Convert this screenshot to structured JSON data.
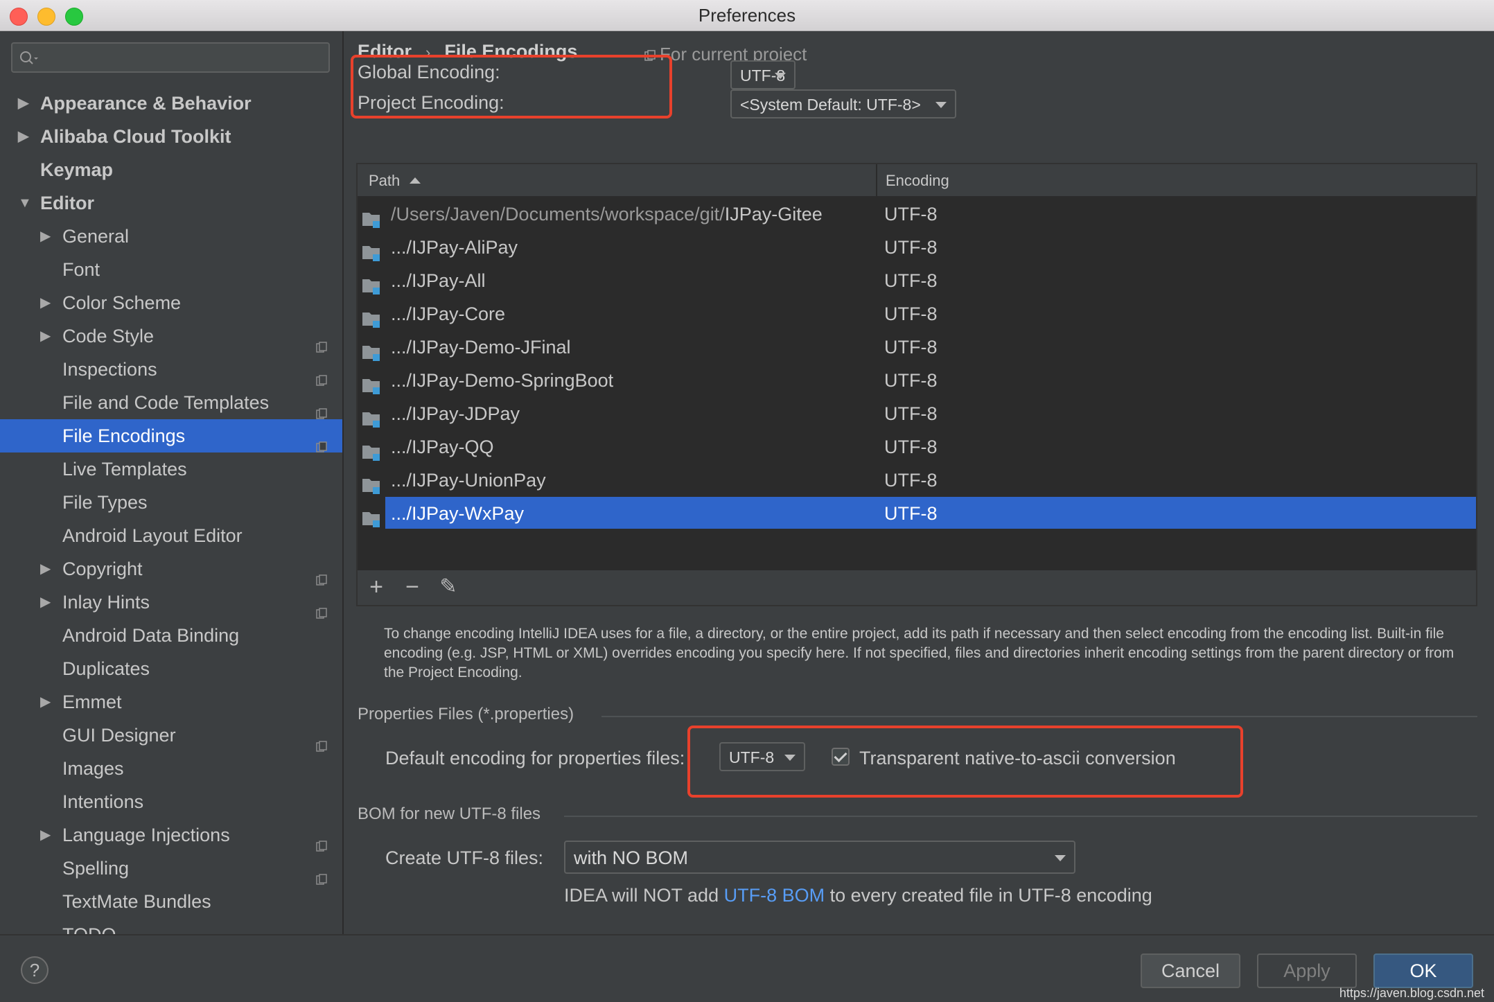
{
  "window": {
    "title": "Preferences"
  },
  "search": {
    "placeholder": ""
  },
  "sidebar": {
    "items": [
      {
        "label": "Appearance & Behavior",
        "bold": true,
        "indent": 0,
        "arrow": "right",
        "project": false
      },
      {
        "label": "Alibaba Cloud Toolkit",
        "bold": true,
        "indent": 0,
        "arrow": "right",
        "project": false
      },
      {
        "label": "Keymap",
        "bold": true,
        "indent": 0,
        "arrow": "",
        "project": false
      },
      {
        "label": "Editor",
        "bold": true,
        "indent": 0,
        "arrow": "down",
        "project": false
      },
      {
        "label": "General",
        "bold": false,
        "indent": 1,
        "arrow": "right",
        "project": false
      },
      {
        "label": "Font",
        "bold": false,
        "indent": 1,
        "arrow": "",
        "project": false
      },
      {
        "label": "Color Scheme",
        "bold": false,
        "indent": 1,
        "arrow": "right",
        "project": false
      },
      {
        "label": "Code Style",
        "bold": false,
        "indent": 1,
        "arrow": "right",
        "project": true
      },
      {
        "label": "Inspections",
        "bold": false,
        "indent": 1,
        "arrow": "",
        "project": true
      },
      {
        "label": "File and Code Templates",
        "bold": false,
        "indent": 1,
        "arrow": "",
        "project": true
      },
      {
        "label": "File Encodings",
        "bold": false,
        "indent": 1,
        "arrow": "",
        "project": true,
        "selected": true
      },
      {
        "label": "Live Templates",
        "bold": false,
        "indent": 1,
        "arrow": "",
        "project": false
      },
      {
        "label": "File Types",
        "bold": false,
        "indent": 1,
        "arrow": "",
        "project": false
      },
      {
        "label": "Android Layout Editor",
        "bold": false,
        "indent": 1,
        "arrow": "",
        "project": false
      },
      {
        "label": "Copyright",
        "bold": false,
        "indent": 1,
        "arrow": "right",
        "project": true
      },
      {
        "label": "Inlay Hints",
        "bold": false,
        "indent": 1,
        "arrow": "right",
        "project": true
      },
      {
        "label": "Android Data Binding",
        "bold": false,
        "indent": 1,
        "arrow": "",
        "project": false
      },
      {
        "label": "Duplicates",
        "bold": false,
        "indent": 1,
        "arrow": "",
        "project": false
      },
      {
        "label": "Emmet",
        "bold": false,
        "indent": 1,
        "arrow": "right",
        "project": false
      },
      {
        "label": "GUI Designer",
        "bold": false,
        "indent": 1,
        "arrow": "",
        "project": true
      },
      {
        "label": "Images",
        "bold": false,
        "indent": 1,
        "arrow": "",
        "project": false
      },
      {
        "label": "Intentions",
        "bold": false,
        "indent": 1,
        "arrow": "",
        "project": false
      },
      {
        "label": "Language Injections",
        "bold": false,
        "indent": 1,
        "arrow": "right",
        "project": true
      },
      {
        "label": "Spelling",
        "bold": false,
        "indent": 1,
        "arrow": "",
        "project": true
      },
      {
        "label": "TextMate Bundles",
        "bold": false,
        "indent": 1,
        "arrow": "",
        "project": false
      },
      {
        "label": "TODO",
        "bold": false,
        "indent": 1,
        "arrow": "",
        "project": false,
        "cut": true
      }
    ]
  },
  "breadcrumb": {
    "parent": "Editor",
    "separator": "›",
    "current": "File Encodings"
  },
  "scope": {
    "label": "For current project"
  },
  "encodings": {
    "global_label": "Global Encoding:",
    "global_value": "UTF-8",
    "project_label": "Project Encoding:",
    "project_value": "<System Default: UTF-8>"
  },
  "table": {
    "columns": [
      "Path",
      "Encoding"
    ],
    "rows": [
      {
        "prefix": "/Users/Javen/Documents/workspace/git/",
        "name": "IJPay-Gitee",
        "encoding": "UTF-8"
      },
      {
        "prefix": "",
        "name": ".../IJPay-AliPay",
        "encoding": "UTF-8"
      },
      {
        "prefix": "",
        "name": ".../IJPay-All",
        "encoding": "UTF-8"
      },
      {
        "prefix": "",
        "name": ".../IJPay-Core",
        "encoding": "UTF-8"
      },
      {
        "prefix": "",
        "name": ".../IJPay-Demo-JFinal",
        "encoding": "UTF-8"
      },
      {
        "prefix": "",
        "name": ".../IJPay-Demo-SpringBoot",
        "encoding": "UTF-8"
      },
      {
        "prefix": "",
        "name": ".../IJPay-JDPay",
        "encoding": "UTF-8"
      },
      {
        "prefix": "",
        "name": ".../IJPay-QQ",
        "encoding": "UTF-8"
      },
      {
        "prefix": "",
        "name": ".../IJPay-UnionPay",
        "encoding": "UTF-8"
      },
      {
        "prefix": "",
        "name": ".../IJPay-WxPay",
        "encoding": "UTF-8",
        "selected": true
      }
    ],
    "toolbar": {
      "add": "+",
      "remove": "−",
      "edit": "✎"
    }
  },
  "help_text": "To change encoding IntelliJ IDEA uses for a file, a directory, or the entire project, add its path if necessary and then select encoding from the encoding list. Built-in file encoding (e.g. JSP, HTML or XML) overrides encoding you specify here. If not specified, files and directories inherit encoding settings from the parent directory or from the Project Encoding.",
  "properties": {
    "section_title": "Properties Files (*.properties)",
    "default_label": "Default encoding for properties files:",
    "default_value": "UTF-8",
    "native_to_ascii_label": "Transparent native-to-ascii conversion",
    "native_to_ascii_checked": true
  },
  "bom": {
    "section_title": "BOM for new UTF-8 files",
    "create_label": "Create UTF-8 files:",
    "create_value": "with NO BOM",
    "note_before": "IDEA will NOT add ",
    "note_link": "UTF-8 BOM",
    "note_after": " to every created file in UTF-8 encoding"
  },
  "footer": {
    "help": "?",
    "cancel": "Cancel",
    "apply": "Apply",
    "ok": "OK"
  },
  "watermark": "https://javen.blog.csdn.net",
  "colors": {
    "accent": "#2f65ca",
    "highlight_box": "#e8412c",
    "link": "#589df6",
    "background": "#3c3f41"
  }
}
